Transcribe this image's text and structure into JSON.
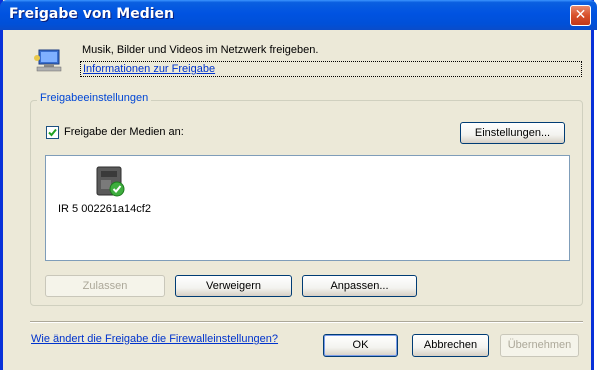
{
  "window": {
    "title": "Freigabe von Medien"
  },
  "header": {
    "description": "Musik, Bilder und Videos im Netzwerk freigeben.",
    "info_link": "Informationen zur Freigabe"
  },
  "settings_group": {
    "legend": "Freigabeeinstellungen",
    "share_checkbox": {
      "label": "Freigabe der Medien an:",
      "checked": true
    },
    "settings_button": "Einstellungen...",
    "devices": [
      {
        "name": "IR 5 002261a14cf2",
        "status": "allowed",
        "icon": "media-device-icon"
      }
    ],
    "allow_button": "Zulassen",
    "deny_button": "Verweigern",
    "customize_button": "Anpassen..."
  },
  "footer": {
    "firewall_link": "Wie ändert die Freigabe die Firewalleinstellungen?",
    "ok_button": "OK",
    "cancel_button": "Abbrechen",
    "apply_button": "Übernehmen"
  },
  "colors": {
    "titlebar": "#0053e1",
    "dialog_bg": "#ece9d8",
    "link": "#0033cc"
  }
}
